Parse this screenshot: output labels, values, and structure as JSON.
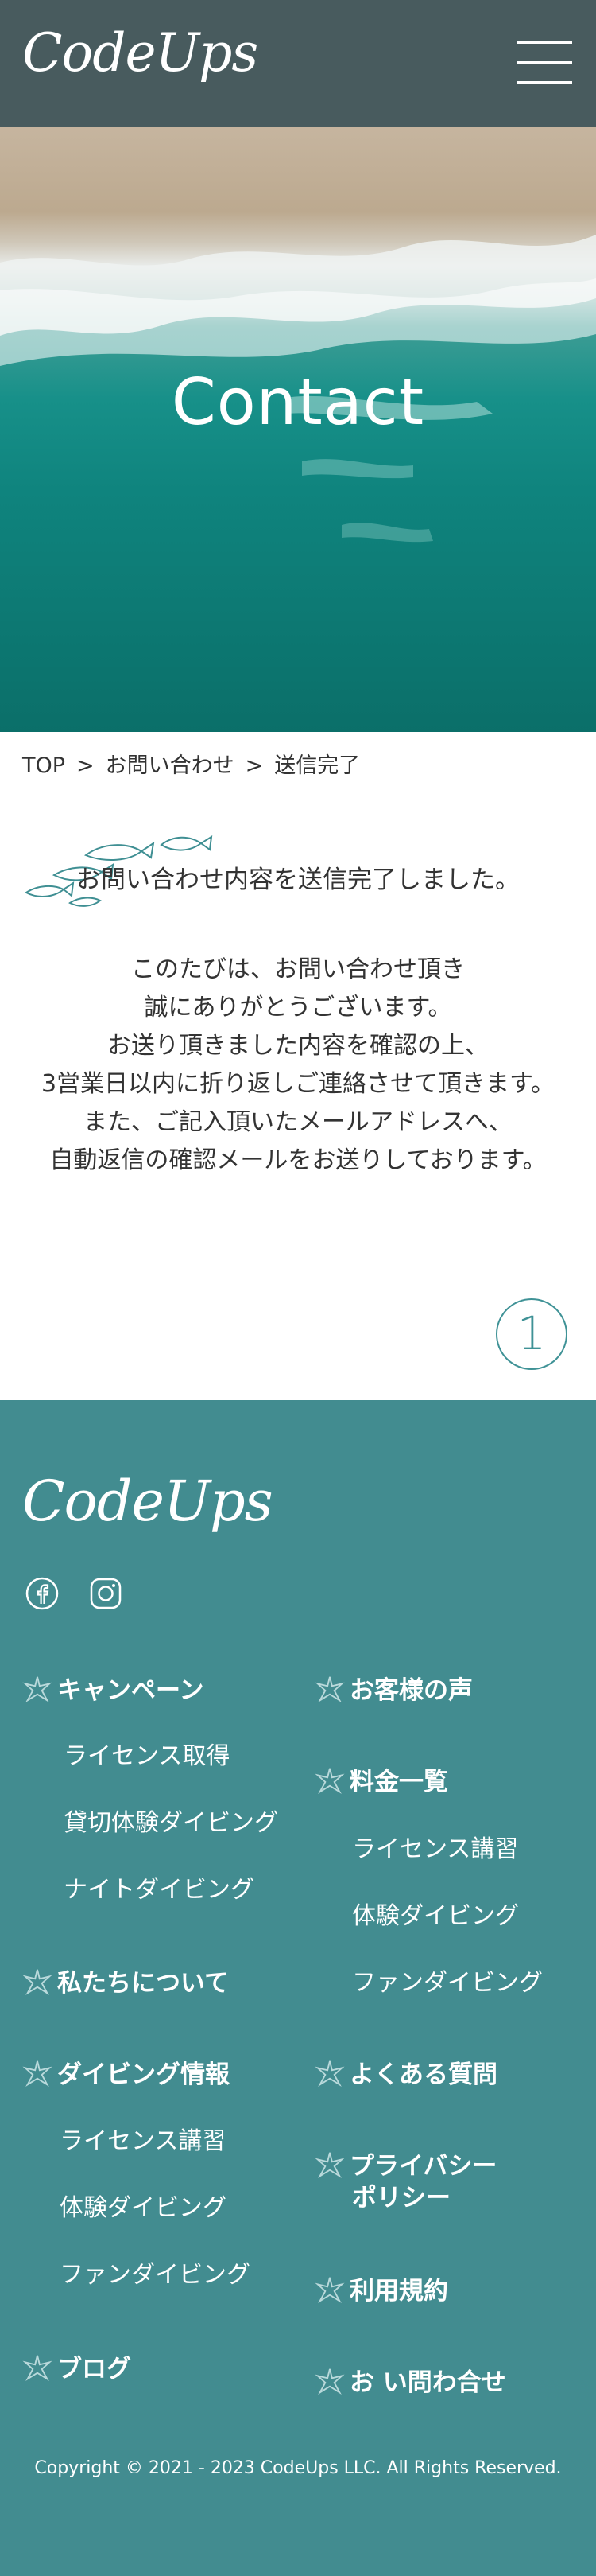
{
  "header": {
    "logo": "CodeUps",
    "menu_icon": "hamburger-menu-icon"
  },
  "hero": {
    "title": "Contact"
  },
  "breadcrumb": {
    "items": [
      "TOP",
      "お問い合わせ",
      "送信完了"
    ],
    "separator": ">"
  },
  "thanks": {
    "title": "お問い合わせ内容を送信完了しました。",
    "lines": [
      "このたびは、お問い合わせ頂き",
      "誠にありがとうございます。",
      "お送り頂きました内容を確認の上、",
      "3営業日以内に折り返しご連絡させて頂きます。",
      "また、ご記入頂いたメールアドレスへ、",
      "自動返信の確認メールをお送りしております。"
    ]
  },
  "page_top": {
    "label": "1"
  },
  "footer": {
    "logo": "CodeUps",
    "sns": [
      "facebook-icon",
      "instagram-icon"
    ],
    "nav": {
      "campaign": "キャンペーン",
      "campaign_items": [
        "ライセンス取得",
        "貸切体験ダイビング",
        "ナイトダイビング"
      ],
      "about": "私たちについて",
      "info": "ダイビング情報",
      "info_items": [
        "ライセンス講習",
        "体験ダイビング",
        "ファンダイビング"
      ],
      "blog": "ブログ",
      "voice": "お客様の声",
      "price": "料金一覧",
      "price_items": [
        "ライセンス講習",
        "体験ダイビング",
        "ファンダイビング"
      ],
      "faq": "よくある質問",
      "privacy_line1": "プライバシー",
      "privacy_line2": "ポリシー",
      "terms": "利用規約",
      "contact": "お い問わ合せ"
    },
    "copyright": "Copyright © 2021 - 2023 CodeUps LLC. All Rights Reserved."
  },
  "colors": {
    "header_bg": "#485b5e",
    "footer_bg": "#428c90",
    "accent": "#3f9296"
  }
}
